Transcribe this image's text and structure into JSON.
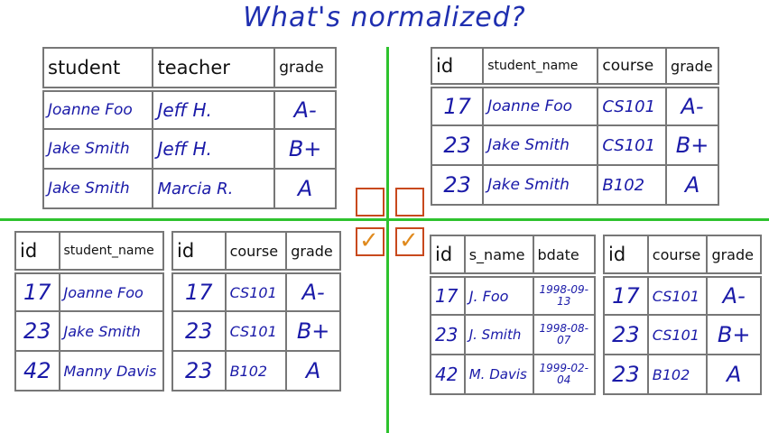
{
  "title": "What's normalized?",
  "tl": {
    "headers": [
      "student",
      "teacher",
      "grade"
    ],
    "rows": [
      [
        "Joanne Foo",
        "Jeff H.",
        "A-"
      ],
      [
        "Jake Smith",
        "Jeff H.",
        "B+"
      ],
      [
        "Jake Smith",
        "Marcia R.",
        "A"
      ]
    ]
  },
  "tr": {
    "headers": [
      "id",
      "student_name",
      "course",
      "grade"
    ],
    "rows": [
      [
        "17",
        "Joanne Foo",
        "CS101",
        "A-"
      ],
      [
        "23",
        "Jake Smith",
        "CS101",
        "B+"
      ],
      [
        "23",
        "Jake Smith",
        "B102",
        "A"
      ]
    ]
  },
  "bl1": {
    "headers": [
      "id",
      "student_name"
    ],
    "rows": [
      [
        "17",
        "Joanne Foo"
      ],
      [
        "23",
        "Jake Smith"
      ],
      [
        "42",
        "Manny Davis"
      ]
    ]
  },
  "bl2": {
    "headers": [
      "id",
      "course",
      "grade"
    ],
    "rows": [
      [
        "17",
        "CS101",
        "A-"
      ],
      [
        "23",
        "CS101",
        "B+"
      ],
      [
        "23",
        "B102",
        "A"
      ]
    ]
  },
  "br1": {
    "headers": [
      "id",
      "s_name",
      "bdate"
    ],
    "rows": [
      [
        "17",
        "J. Foo",
        "1998-09-13"
      ],
      [
        "23",
        "J. Smith",
        "1998-08-07"
      ],
      [
        "42",
        "M. Davis",
        "1999-02-04"
      ]
    ]
  },
  "br2": {
    "headers": [
      "id",
      "course",
      "grade"
    ],
    "rows": [
      [
        "17",
        "CS101",
        "A-"
      ],
      [
        "23",
        "CS101",
        "B+"
      ],
      [
        "23",
        "B102",
        "A"
      ]
    ]
  },
  "checks": {
    "mark": "✓"
  }
}
